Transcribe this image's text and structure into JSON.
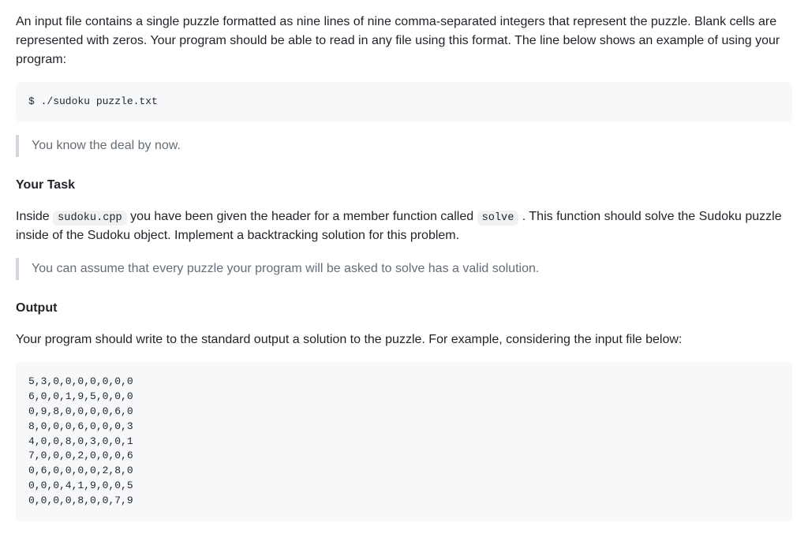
{
  "intro": {
    "paragraph": "An input file contains a single puzzle formatted as nine lines of nine comma-separated integers that represent the puzzle. Blank cells are represented with zeros. Your program should be able to read in any file using this format. The line below shows an example of using your program:"
  },
  "command_example": "$ ./sudoku puzzle.txt",
  "blockquote1": "You know the deal by now.",
  "task": {
    "heading": "Your Task",
    "para_part1": "Inside ",
    "code1": "sudoku.cpp",
    "para_part2": " you have been given the header for a member function called ",
    "code2": "solve",
    "para_part3": " . This function should solve the Sudoku puzzle inside of the Sudoku object. Implement a backtracking solution for this problem."
  },
  "blockquote2": "You can assume that every puzzle your program will be asked to solve has a valid solution.",
  "output": {
    "heading": "Output",
    "paragraph": "Your program should write to the standard output a solution to the puzzle. For example, considering the input file below:"
  },
  "puzzle_input": "5,3,0,0,0,0,0,0,0\n6,0,0,1,9,5,0,0,0\n0,9,8,0,0,0,0,6,0\n8,0,0,0,6,0,0,0,3\n4,0,0,8,0,3,0,0,1\n7,0,0,0,2,0,0,0,6\n0,6,0,0,0,0,2,8,0\n0,0,0,4,1,9,0,0,5\n0,0,0,0,8,0,0,7,9"
}
